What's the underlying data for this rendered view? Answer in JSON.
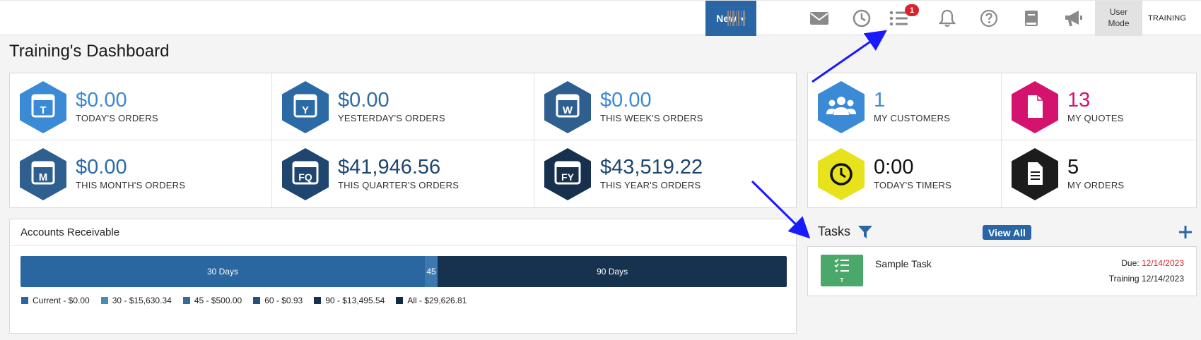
{
  "topbar": {
    "new_label": "New",
    "notification_badge": "1",
    "user_mode_line1": "User",
    "user_mode_line2": "Mode",
    "user_name": "TRAINING",
    "icons": [
      "barcode-icon",
      "mail-icon",
      "clock-icon",
      "task-list-icon",
      "bell-icon",
      "help-icon",
      "book-icon",
      "megaphone-icon"
    ]
  },
  "page_title": "Training's Dashboard",
  "orders": [
    {
      "icon_letter": "T",
      "value": "$0.00",
      "label": "TODAY'S ORDERS",
      "color": "#3a8ad6"
    },
    {
      "icon_letter": "Y",
      "value": "$0.00",
      "label": "YESTERDAY'S ORDERS",
      "color": "#2c6aa6"
    },
    {
      "icon_letter": "W",
      "value": "$0.00",
      "label": "THIS WEEK'S ORDERS",
      "color": "#2e5f8f"
    },
    {
      "icon_letter": "M",
      "value": "$0.00",
      "label": "THIS MONTH'S ORDERS",
      "color": "#2e5f8f"
    },
    {
      "icon_letter": "FQ",
      "value": "$41,946.56",
      "label": "THIS QUARTER'S ORDERS",
      "color": "#1e466e"
    },
    {
      "icon_letter": "FY",
      "value": "$43,519.22",
      "label": "THIS YEAR'S ORDERS",
      "color": "#16304e"
    }
  ],
  "mine": [
    {
      "icon": "customers-icon",
      "value": "1",
      "label": "MY CUSTOMERS",
      "color": "#3a8ad6"
    },
    {
      "icon": "quote-document-icon",
      "value": "13",
      "label": "MY QUOTES",
      "color": "#d4136f"
    },
    {
      "icon": "timer-clock-icon",
      "value": "0:00",
      "label": "TODAY'S TIMERS",
      "color": "#e7e21c"
    },
    {
      "icon": "order-document-icon",
      "value": "5",
      "label": "MY ORDERS",
      "color": "#1c1c1c"
    }
  ],
  "accounts_receivable": {
    "title": "Accounts Receivable",
    "segments": [
      {
        "label": "30 Days",
        "fraction": 0.5276,
        "color": "#2a66a0"
      },
      {
        "label": "45",
        "fraction": 0.0169,
        "color": "#3e78b0"
      },
      {
        "label": "90 Days",
        "fraction": 0.4555,
        "color": "#16324f"
      }
    ],
    "legend": [
      {
        "label": "Current - $0.00",
        "color": "#2a66a0"
      },
      {
        "label": "30 - $15,630.34",
        "color": "#4a8ab8"
      },
      {
        "label": "45 - $500.00",
        "color": "#356b9e"
      },
      {
        "label": "60 - $0.93",
        "color": "#24507c"
      },
      {
        "label": "90 - $13,495.54",
        "color": "#16324f"
      },
      {
        "label": "All - $29,626.81",
        "color": "#0f2a45"
      }
    ]
  },
  "tasks": {
    "title": "Tasks",
    "view_all_label": "View All",
    "items": [
      {
        "name": "Sample Task",
        "due_label": "Due:",
        "due_date": "12/14/2023",
        "assignee_line": "Training 12/14/2023",
        "icon_letter": "T"
      }
    ]
  }
}
